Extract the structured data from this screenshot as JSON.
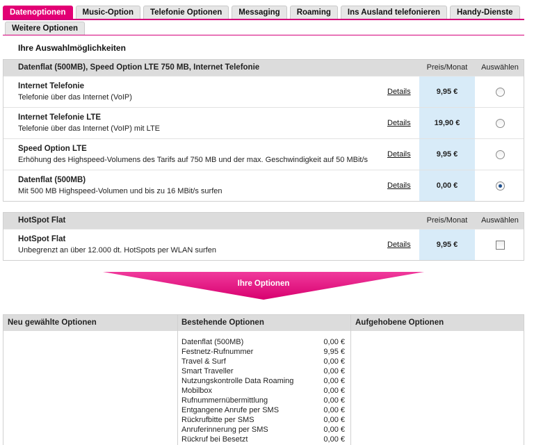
{
  "tabs_row1": [
    "Datenoptionen",
    "Music-Option",
    "Telefonie Optionen",
    "Messaging",
    "Roaming",
    "Ins Ausland telefonieren",
    "Handy-Dienste"
  ],
  "tabs_row2": [
    "Weitere Optionen"
  ],
  "active_tab": "Datenoptionen",
  "section_title": "Ihre Auswahlmöglichkeiten",
  "box1": {
    "title": "Datenflat (500MB), Speed Option LTE 750 MB, Internet Telefonie",
    "price_header": "Preis/Monat",
    "select_header": "Auswählen",
    "rows": [
      {
        "title": "Internet Telefonie",
        "desc": "Telefonie über das Internet (VoIP)",
        "details": "Details",
        "price": "9,95 €",
        "selected": false
      },
      {
        "title": "Internet Telefonie LTE",
        "desc": "Telefonie über das Internet (VoIP) mit LTE",
        "details": "Details",
        "price": "19,90 €",
        "selected": false
      },
      {
        "title": "Speed Option LTE",
        "desc": "Erhöhung des Highspeed-Volumens des Tarifs auf 750 MB und der max. Geschwindigkeit auf 50 MBit/s",
        "details": "Details",
        "price": "9,95 €",
        "selected": false
      },
      {
        "title": "Datenflat (500MB)",
        "desc": "Mit 500 MB Highspeed-Volumen und bis zu 16 MBit/s surfen",
        "details": "Details",
        "price": "0,00 €",
        "selected": true
      }
    ]
  },
  "box2": {
    "title": "HotSpot Flat",
    "price_header": "Preis/Monat",
    "select_header": "Auswählen",
    "rows": [
      {
        "title": "HotSpot Flat",
        "desc": "Unbegrenzt an über 12.000 dt. HotSpots per WLAN surfen",
        "details": "Details",
        "price": "9,95 €",
        "checked": false
      }
    ]
  },
  "arrow_label": "Ihre Optionen",
  "options_table": {
    "col1_header": "Neu gewählte Optionen",
    "col2_header": "Bestehende Optionen",
    "col3_header": "Aufgehobene Optionen",
    "existing": [
      {
        "name": "Datenflat (500MB)",
        "price": "0,00 €"
      },
      {
        "name": "Festnetz-Rufnummer",
        "price": "9,95 €"
      },
      {
        "name": "Travel & Surf",
        "price": "0,00 €"
      },
      {
        "name": "Smart Traveller",
        "price": "0,00 €"
      },
      {
        "name": "Nutzungskontrolle Data Roaming",
        "price": "0,00 €"
      },
      {
        "name": "Mobilbox",
        "price": "0,00 €"
      },
      {
        "name": "Rufnummernübermittlung",
        "price": "0,00 €"
      },
      {
        "name": "Entgangene Anrufe per SMS",
        "price": "0,00 €"
      },
      {
        "name": "Rückrufbitte per SMS",
        "price": "0,00 €"
      },
      {
        "name": "Anruferinnerung per SMS",
        "price": "0,00 €"
      },
      {
        "name": "Rückruf bei Besetzt",
        "price": "0,00 €"
      }
    ]
  },
  "colors": {
    "accent": "#e20074",
    "price_bg": "#d8ebf8",
    "header_bg": "#dcdcdc"
  }
}
